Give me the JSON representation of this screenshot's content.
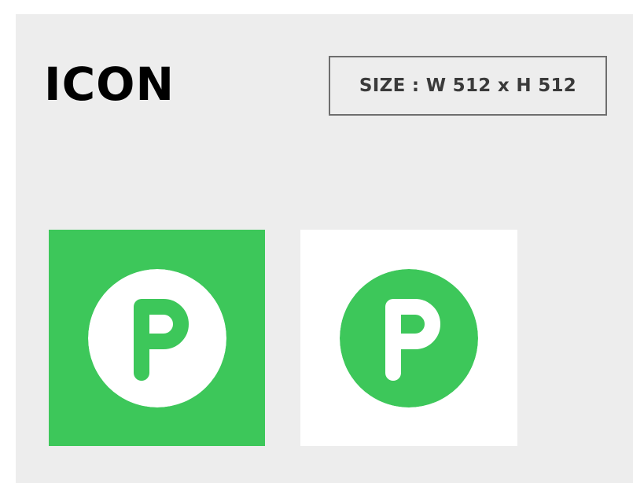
{
  "header": {
    "title": "ICON",
    "size_label": "SIZE : W 512 x H 512"
  },
  "icons": [
    {
      "name": "parking-icon-green-background",
      "background": "#3dc75a",
      "circle": "#ffffff",
      "letter_color": "#3dc75a",
      "letter": "P"
    },
    {
      "name": "parking-icon-white-background",
      "background": "#ffffff",
      "circle": "#3dc75a",
      "letter_color": "#ffffff",
      "letter": "P"
    }
  ]
}
